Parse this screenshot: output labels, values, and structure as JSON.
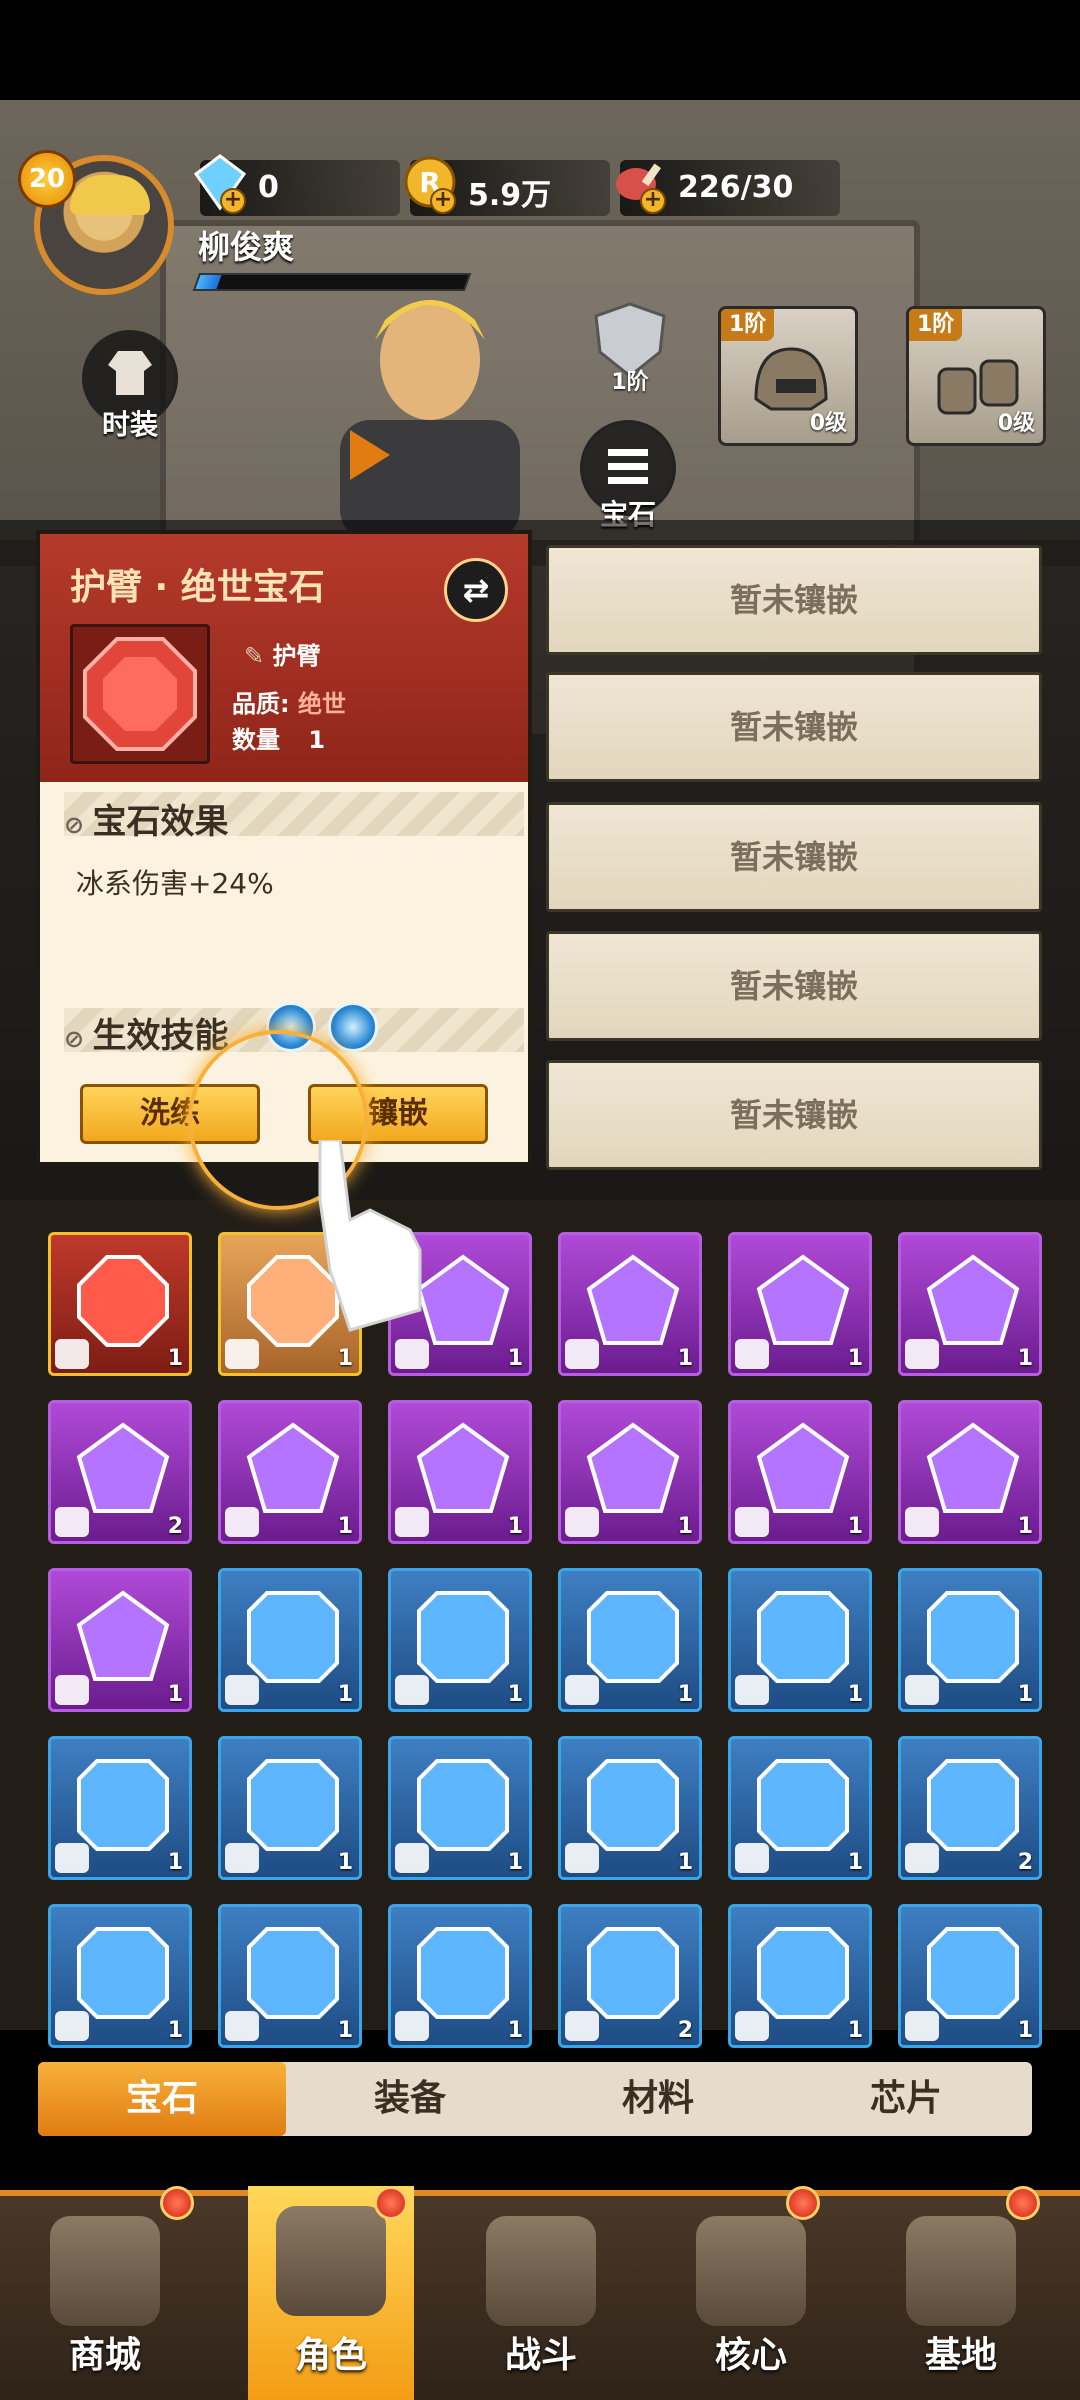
{
  "player": {
    "level": "20",
    "name": "柳俊爽",
    "xp_fraction": 0.08
  },
  "resources": {
    "diamond": "0",
    "gold": "5.9万",
    "stamina": "226/30"
  },
  "side_buttons": {
    "fashion": "时装",
    "gem": "宝石"
  },
  "equipment": {
    "armor_tier": "1阶",
    "slots": [
      {
        "tier": "1阶",
        "level": "0级",
        "item": "helmet"
      },
      {
        "tier": "1阶",
        "level": "0级",
        "item": "gauntlets"
      }
    ]
  },
  "sockets": [
    "暂未镶嵌",
    "暂未镶嵌",
    "暂未镶嵌",
    "暂未镶嵌",
    "暂未镶嵌"
  ],
  "card": {
    "title": "护臂 · 绝世宝石",
    "part": "护臂",
    "quality_label": "品质:",
    "quality_value": "绝世",
    "count_label": "数量",
    "count_value": "1",
    "effect_header": "宝石效果",
    "effect_text": "冰系伤害+24%",
    "skills_header": "生效技能",
    "reroll_button": "洗练",
    "inlay_button": "镶嵌"
  },
  "inventory": [
    {
      "rarity": "red",
      "gem": "octagon",
      "count": "1",
      "part": "armguard"
    },
    {
      "rarity": "orange",
      "gem": "octagon",
      "count": "1",
      "part": "pants"
    },
    {
      "rarity": "purple",
      "gem": "pentagon",
      "count": "1",
      "part": "helmet"
    },
    {
      "rarity": "purple",
      "gem": "pentagon",
      "count": "1",
      "part": "helmet"
    },
    {
      "rarity": "purple",
      "gem": "pentagon",
      "count": "1",
      "part": "gloves"
    },
    {
      "rarity": "purple",
      "gem": "pentagon",
      "count": "1",
      "part": "boots"
    },
    {
      "rarity": "purple",
      "gem": "pentagon",
      "count": "2",
      "part": "boots"
    },
    {
      "rarity": "purple",
      "gem": "pentagon",
      "count": "1",
      "part": "boots"
    },
    {
      "rarity": "purple",
      "gem": "pentagon",
      "count": "1",
      "part": "boots"
    },
    {
      "rarity": "purple",
      "gem": "pentagon",
      "count": "1",
      "part": "boots"
    },
    {
      "rarity": "purple",
      "gem": "pentagon",
      "count": "1",
      "part": "pants"
    },
    {
      "rarity": "purple",
      "gem": "pentagon",
      "count": "1",
      "part": "pants"
    },
    {
      "rarity": "purple",
      "gem": "pentagon",
      "count": "1",
      "part": "glove"
    },
    {
      "rarity": "blue",
      "gem": "square",
      "count": "1",
      "part": "helmet"
    },
    {
      "rarity": "blue",
      "gem": "square",
      "count": "1",
      "part": "helmet"
    },
    {
      "rarity": "blue",
      "gem": "square",
      "count": "1",
      "part": "helmet"
    },
    {
      "rarity": "blue",
      "gem": "square",
      "count": "1",
      "part": "helmet"
    },
    {
      "rarity": "blue",
      "gem": "square",
      "count": "1",
      "part": "gloves"
    },
    {
      "rarity": "blue",
      "gem": "square",
      "count": "1",
      "part": "gloves"
    },
    {
      "rarity": "blue",
      "gem": "square",
      "count": "1",
      "part": "gloves"
    },
    {
      "rarity": "blue",
      "gem": "square",
      "count": "1",
      "part": "gloves"
    },
    {
      "rarity": "blue",
      "gem": "square",
      "count": "1",
      "part": "boots"
    },
    {
      "rarity": "blue",
      "gem": "square",
      "count": "1",
      "part": "armguard"
    },
    {
      "rarity": "blue",
      "gem": "square",
      "count": "2",
      "part": "armguard"
    },
    {
      "rarity": "blue",
      "gem": "square",
      "count": "1",
      "part": "pants"
    },
    {
      "rarity": "blue",
      "gem": "square",
      "count": "1",
      "part": "pants"
    },
    {
      "rarity": "blue",
      "gem": "square",
      "count": "1",
      "part": "pants"
    },
    {
      "rarity": "blue",
      "gem": "square",
      "count": "2",
      "part": "glove"
    },
    {
      "rarity": "blue",
      "gem": "square",
      "count": "1",
      "part": "glove"
    },
    {
      "rarity": "blue",
      "gem": "square",
      "count": "1",
      "part": "glove"
    }
  ],
  "tabs": [
    "宝石",
    "装备",
    "材料",
    "芯片"
  ],
  "nav": [
    "商城",
    "角色",
    "战斗",
    "核心",
    "基地"
  ],
  "colors": {
    "accent": "#f39b12",
    "card_header": "#b53a2c",
    "epic": "#b04ad8",
    "rare": "#3e7fc2"
  }
}
